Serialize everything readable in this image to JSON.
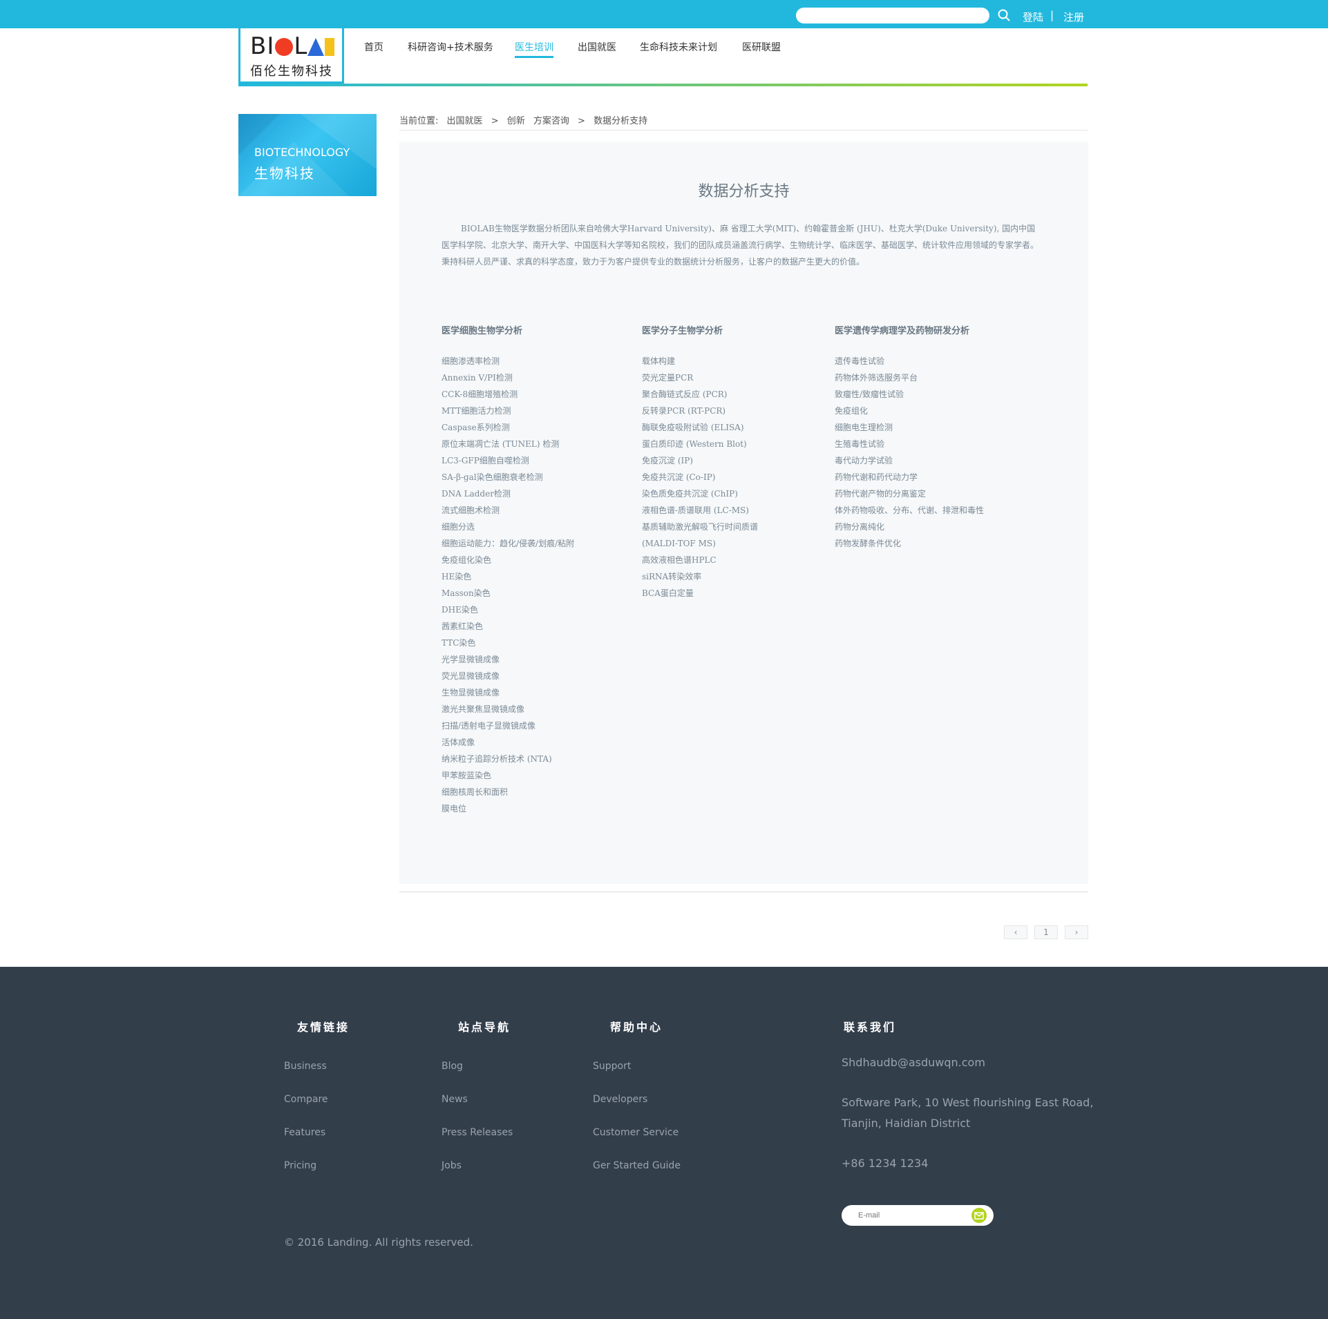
{
  "topbar": {
    "search_placeholder": "",
    "login": "登陆",
    "separator": "|",
    "register": "注册",
    "bg_color": "#22b8dd"
  },
  "header": {
    "logo_en": {
      "b": "BI",
      "o": "O",
      "l": "L",
      "a": "A",
      "b2": "B"
    },
    "logo_cn": "佰伦生物科技",
    "nav": [
      "首页",
      "科研咨询+技术服务",
      "医生培训",
      "出国就医",
      "生命科技未来计划",
      "医研联盟"
    ],
    "active_nav": "医生培训",
    "gradient": [
      "#22b8dd",
      "#b2d420"
    ]
  },
  "banner": {
    "en": "BIOTECHNOLOGY",
    "cn": "生物科技"
  },
  "breadcrumb": {
    "label": "当前位置:",
    "items": [
      "出国就医",
      ">",
      "创新",
      "方案咨询",
      ">",
      "数据分析支持"
    ]
  },
  "panel": {
    "title": "数据分析支持",
    "intro": "BIOLAB生物医学数据分析团队来自哈佛大学Harvard University)、麻 省理工大学(MIT)、约翰霍普金斯 (JHU)、杜克大学(Duke University), 国内中国医学科学院、北京大学、南开大学、中国医科大学等知名院校，我们的团队成员涵盖流行病学、生物统计学、临床医学、基础医学、统计软件应用领域的专家学者。秉持科研人员严谨、求真的科学态度，致力于为客户提供专业的数据统计分析服务，让客户的数据产生更大的价值。",
    "columns": [
      {
        "heading": "医学细胞生物学分析",
        "items": [
          "细胞渗透率检测",
          "Annexin V/PI检测",
          "CCK-8细胞增殖检测",
          "MTT细胞活力检测",
          "Caspase系列检测",
          "原位末端凋亡法 (TUNEL) 检测",
          "LC3-GFP细胞自噬检测",
          "SA-β-gal染色细胞衰老检测",
          "DNA Ladder检测",
          "流式细胞术检测",
          "细胞分选",
          "细胞运动能力：趋化/侵袭/划痕/粘附",
          "免疫组化染色",
          "HE染色",
          "Masson染色",
          "DHE染色",
          "茜素红染色",
          "TTC染色",
          "光学显微镜成像",
          "荧光显微镜成像",
          "生物显微镜成像",
          "激光共聚焦显微镜成像",
          "扫描/透射电子显微镜成像",
          "活体成像",
          "纳米粒子追踪分析技术 (NTA)",
          "甲苯胺蓝染色",
          "细胞核周长和面积",
          "膜电位"
        ]
      },
      {
        "heading": "医学分子生物学分析",
        "items": [
          "载体构建",
          "荧光定量PCR",
          "聚合酶链式反应 (PCR)",
          "反转录PCR (RT-PCR)",
          "酶联免疫吸附试验 (ELISA)",
          "蛋白质印迹 (Western Blot)",
          "免疫沉淀 (IP)",
          "免疫共沉淀 (Co-IP)",
          "染色质免疫共沉淀 (ChIP)",
          "液相色谱-质谱联用 (LC-MS)",
          "基质辅助激光解吸飞行时间质谱",
          "(MALDI-TOF MS)",
          "高效液相色谱HPLC",
          "siRNA转染效率",
          "BCA蛋白定量"
        ]
      },
      {
        "heading": "医学遗传学病理学及药物研发分析",
        "items": [
          "遗传毒性试验",
          "药物体外筛选服务平台",
          "致瘤性/致瘤性试验",
          "免疫组化",
          "细胞电生理检测",
          "生殖毒性试验",
          "毒代动力学试验",
          "药物代谢和药代动力学",
          "药物代谢产物的分离鉴定",
          "体外药物吸收、分布、代谢、排泄和毒性",
          "药物分离纯化",
          "药物发酵条件优化"
        ]
      }
    ]
  },
  "pager": {
    "prev": "‹",
    "page": "1",
    "next": "›"
  },
  "footer": {
    "headings": [
      "友情链接",
      "站点导航",
      "帮助中心",
      "联系我们"
    ],
    "col1": [
      "Business",
      "Compare",
      "Features",
      "Pricing"
    ],
    "col2": [
      "Blog",
      "News",
      "Press Releases",
      "Jobs"
    ],
    "col3": [
      "Support",
      "Developers",
      "Customer Service",
      "Ger Started Guide"
    ],
    "email_addr": "Shdhaudb@asduwqn.com",
    "address1": "Software Park, 10 West flourishing East Road,",
    "address2": "Tianjin, Haidian District",
    "phone": "+86 1234 1234",
    "email_placeholder": "E-mail",
    "copyright": "© 2016 Landing. All rights reserved."
  }
}
